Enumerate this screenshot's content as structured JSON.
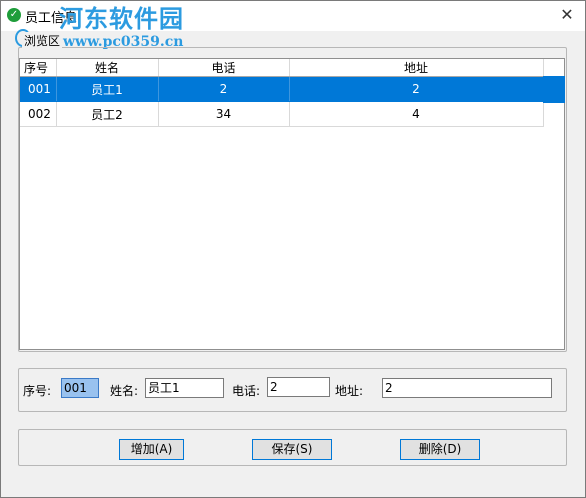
{
  "window": {
    "title": "员工信息",
    "close_glyph": "✕"
  },
  "watermark": {
    "title": "河东软件园",
    "url": "www.pc0359.cn"
  },
  "browse_group": {
    "legend": "浏览区"
  },
  "table": {
    "columns": [
      "序号",
      "姓名",
      "电话",
      "地址"
    ],
    "rows": [
      {
        "id": "001",
        "name": "员工1",
        "phone": "2",
        "address": "2",
        "selected": true
      },
      {
        "id": "002",
        "name": "员工2",
        "phone": "34",
        "address": "4",
        "selected": false
      }
    ]
  },
  "form": {
    "id_label": "序号:",
    "id_value": "001",
    "name_label": "姓名:",
    "name_value": "员工1",
    "phone_label": "电话:",
    "phone_value": "2",
    "address_label": "地址:",
    "address_value": "2"
  },
  "buttons": {
    "add": "增加(A)",
    "save": "保存(S)",
    "delete": "删除(D)"
  },
  "colors": {
    "selection": "#0078d7",
    "button_border": "#0078d7",
    "watermark": "#2c9be0"
  },
  "icons": {
    "app": "check-circle-icon",
    "close": "close-icon"
  }
}
